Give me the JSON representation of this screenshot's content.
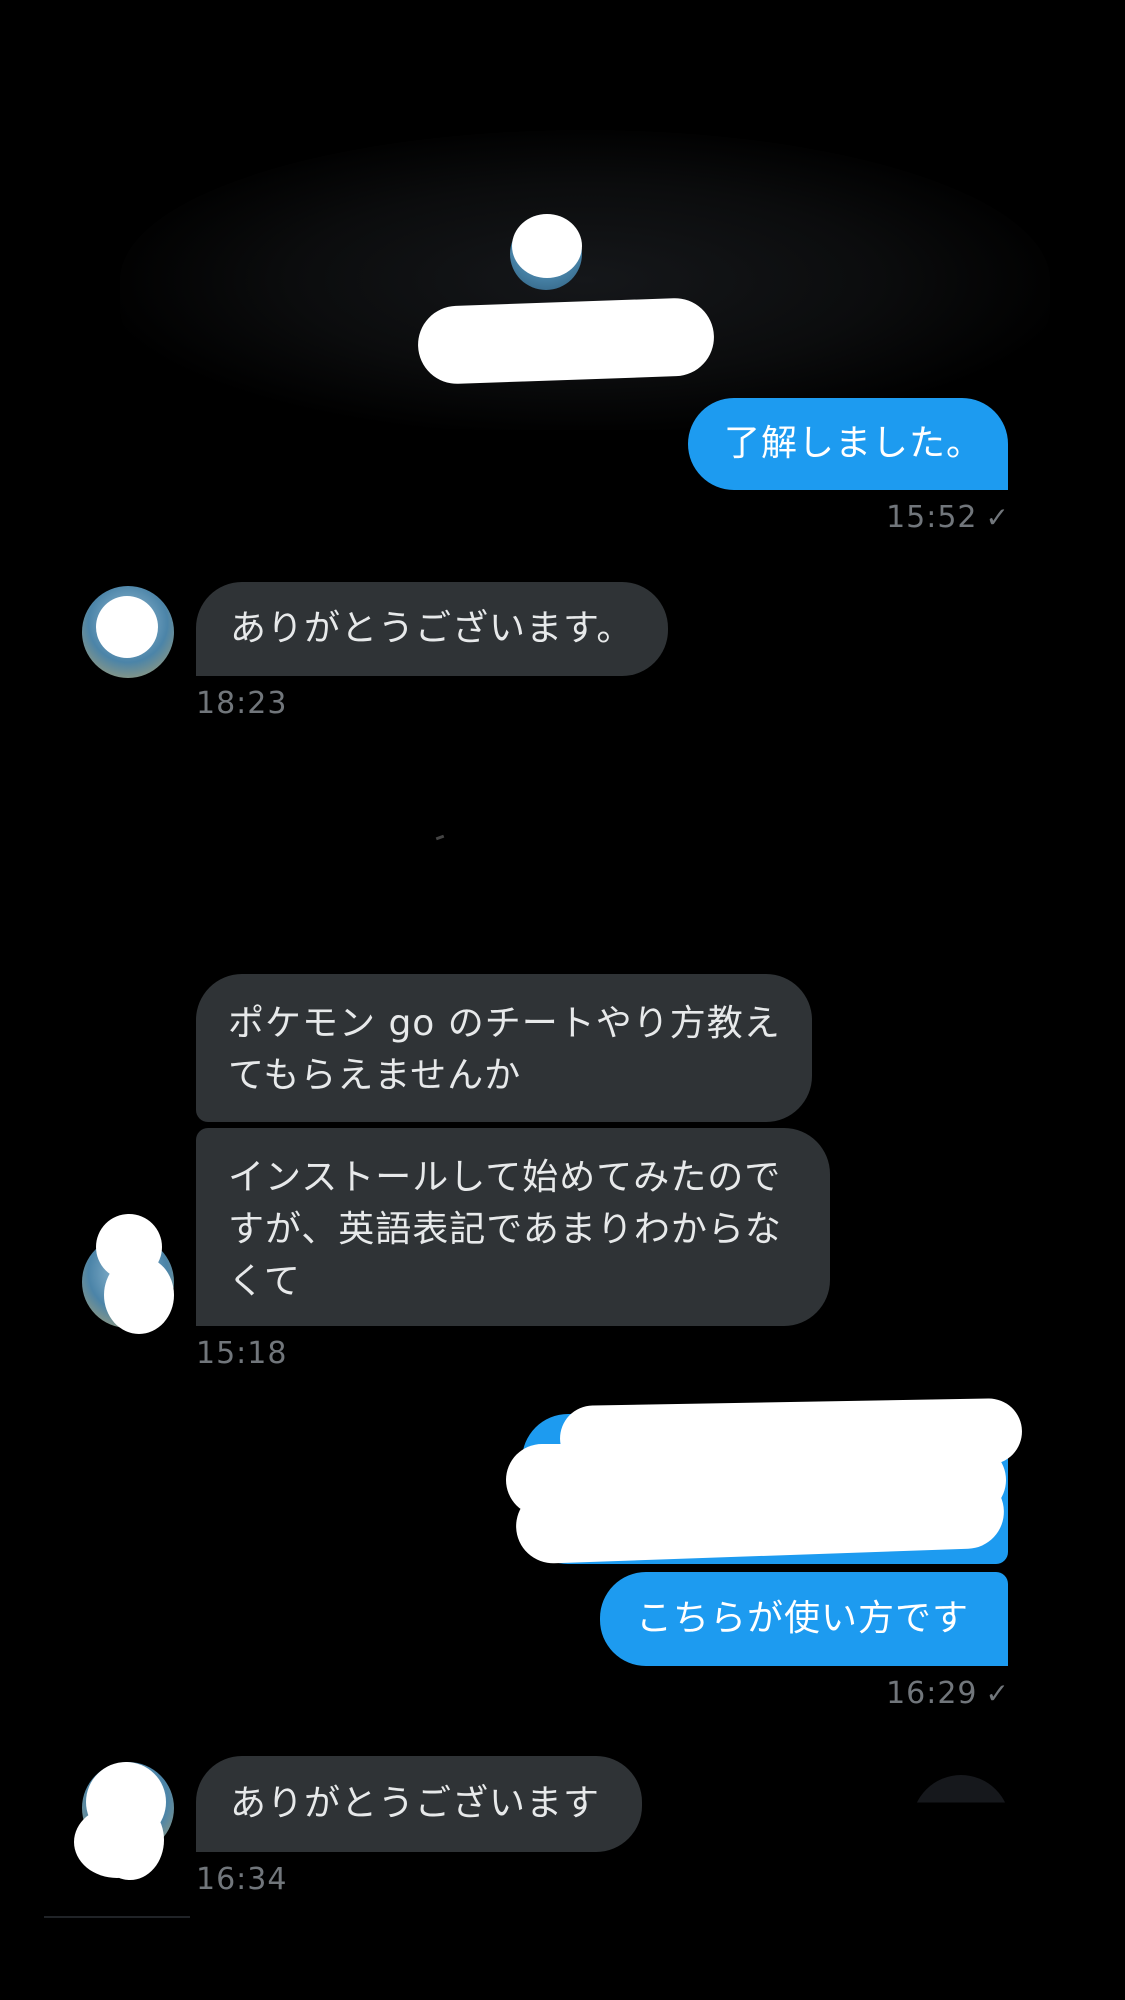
{
  "colors": {
    "background": "#000000",
    "outgoing_bubble": "#1d9bf0",
    "incoming_bubble": "#2f3336",
    "timestamp": "#71767b"
  },
  "icons": {
    "read_check": "✓"
  },
  "messages": {
    "m1": {
      "text": "了解しました。",
      "direction": "outgoing"
    },
    "t1": "15:52",
    "m2": {
      "text": "ありがとうございます。",
      "direction": "incoming"
    },
    "t2": "18:23",
    "m3": {
      "text": "ポケモン go のチートやり方教え\nてもらえませんか",
      "direction": "incoming"
    },
    "m4": {
      "text": "インストールして始めてみたので\nすが、英語表記であまりわからな\nくて",
      "direction": "incoming"
    },
    "t3": "15:18",
    "m5": {
      "text": "",
      "direction": "outgoing"
    },
    "m6": {
      "text": "こちらが使い方です",
      "direction": "outgoing"
    },
    "t4": "16:29",
    "m7": {
      "text": "ありがとうございます",
      "direction": "incoming"
    },
    "t5": "16:34"
  }
}
